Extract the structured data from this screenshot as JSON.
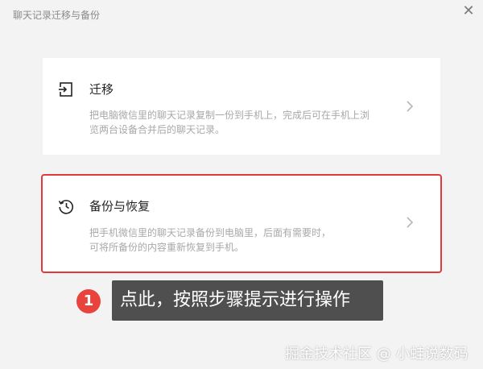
{
  "window": {
    "title": "聊天记录迁移与备份",
    "close_icon": "close-icon"
  },
  "options": [
    {
      "id": "migrate",
      "icon": "migrate-icon",
      "title": "迁移",
      "description_line1": "把电脑微信里的聊天记录复制一份到手机上，完成后可在手机上浏",
      "description_line2": "览两台设备合并后的聊天记录。"
    },
    {
      "id": "backup",
      "icon": "history-icon",
      "title": "备份与恢复",
      "description_line1": "把手机微信里的聊天记录备份到电脑里，后面有需要时，",
      "description_line2": "可将所备份的内容重新恢复到手机。"
    }
  ],
  "annotation": {
    "step_number": "1",
    "tooltip_text": "点此，按照步骤提示进行操作",
    "highlight_color": "#e4393c"
  },
  "watermark": "掘金技术社区 @ 小蛙说数码"
}
